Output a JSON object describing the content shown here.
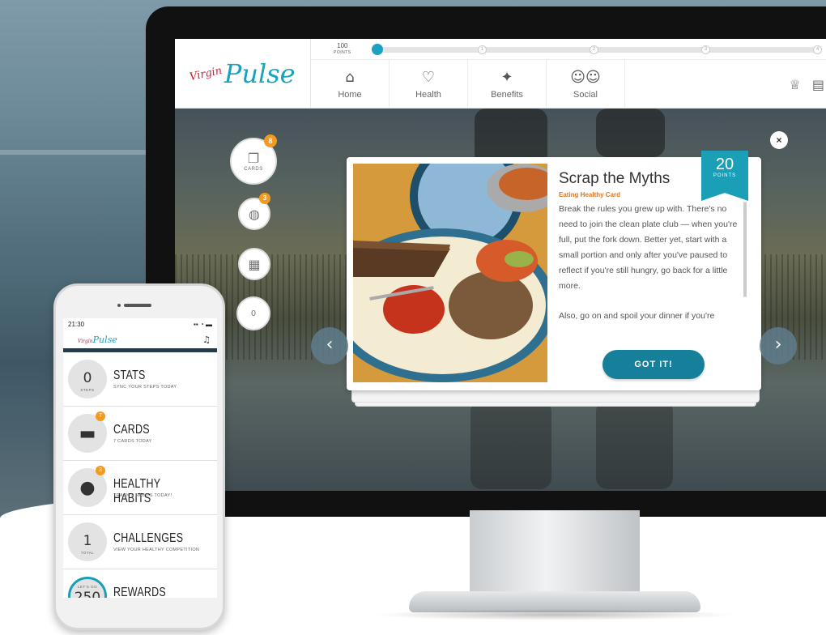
{
  "app": {
    "logo_brand": "Virgin",
    "logo_text": "Pulse"
  },
  "progress": {
    "points_value": "100",
    "points_label": "POINTS",
    "milestones": [
      "1",
      "2",
      "3",
      "4"
    ],
    "fill_fraction": 0
  },
  "nav": {
    "items": [
      {
        "label": "Home",
        "icon": "home-icon"
      },
      {
        "label": "Health",
        "icon": "heart-icon"
      },
      {
        "label": "Benefits",
        "icon": "hand-stars-icon"
      },
      {
        "label": "Social",
        "icon": "people-icon"
      }
    ],
    "right_icons": [
      "trophy-icon",
      "calendar-icon"
    ]
  },
  "rail": {
    "cards_label": "CARDS",
    "cards_badge": "8",
    "habits_badge": "3",
    "steps_value": "0"
  },
  "card": {
    "title": "Scrap the Myths",
    "subtitle": "Eating Healthy Card",
    "points_value": "20",
    "points_label": "POINTS",
    "body_p1": "Break the rules you grew up with. There's no need to join the clean plate club — when you're full, put the fork down. Better yet, start with a small portion and only after you've paused to reflect if you're still hungry, go back for a little more.",
    "body_p2": "Also, go on and spoil your dinner if you're",
    "button_label": "GOT IT!",
    "close_label": "×"
  },
  "phone": {
    "time": "21:30",
    "status_icons": "▪▪ ◔ ▬",
    "logo_brand": "Virgin",
    "logo_text": "Pulse",
    "rows": [
      {
        "title": "STATS",
        "subtitle": "SYNC YOUR STEPS TODAY",
        "value": "0",
        "value_label": "STEPS"
      },
      {
        "title": "CARDS",
        "subtitle": "7 CARDS TODAY",
        "badge": "7",
        "icon": "cards-icon"
      },
      {
        "title": "HEALTHY HABITS",
        "subtitle": "TRACK 3 HABITS TODAY!",
        "badge": "3",
        "icon": "pear-icon"
      },
      {
        "title": "CHALLENGES",
        "subtitle": "VIEW YOUR HEALTHY COMPETITION",
        "value": "1",
        "value_label": "TOTAL"
      },
      {
        "title": "REWARDS",
        "subtitle": "",
        "value": "250",
        "value_label": "LET'S GO"
      }
    ]
  },
  "colors": {
    "accent": "#1a9fb6",
    "button": "#16809b",
    "badge": "#f39a1f",
    "subtitle": "#e0761e",
    "logo_red": "#d6172c"
  }
}
